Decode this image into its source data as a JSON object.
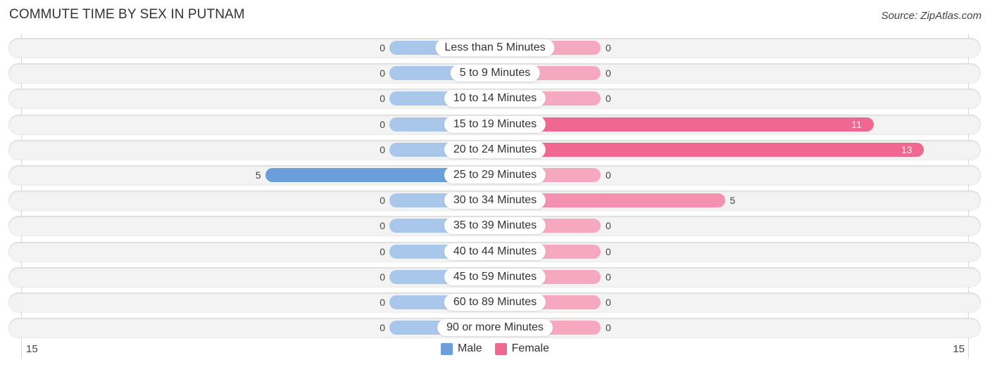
{
  "chart_data": {
    "type": "bar",
    "orientation": "horizontal-diverging",
    "title": "COMMUTE TIME BY SEX IN PUTNAM",
    "source": "Source: ZipAtlas.com",
    "categories": [
      "Less than 5 Minutes",
      "5 to 9 Minutes",
      "10 to 14 Minutes",
      "15 to 19 Minutes",
      "20 to 24 Minutes",
      "25 to 29 Minutes",
      "30 to 34 Minutes",
      "35 to 39 Minutes",
      "40 to 44 Minutes",
      "45 to 59 Minutes",
      "60 to 89 Minutes",
      "90 or more Minutes"
    ],
    "series": [
      {
        "name": "Male",
        "color": "#6a9fdb",
        "light_color": "#a9c7ea",
        "values": [
          0,
          0,
          0,
          0,
          0,
          5,
          0,
          0,
          0,
          0,
          0,
          0
        ]
      },
      {
        "name": "Female",
        "color": "#f06891",
        "light_color": "#f6a8c0",
        "values": [
          0,
          0,
          0,
          11,
          13,
          0,
          5,
          0,
          0,
          0,
          0,
          0
        ]
      }
    ],
    "axis": {
      "left_tick": "15",
      "right_tick": "15",
      "xlim": [
        -15,
        15
      ]
    },
    "legend": {
      "position": "bottom-center",
      "items": [
        "Male",
        "Female"
      ]
    }
  }
}
